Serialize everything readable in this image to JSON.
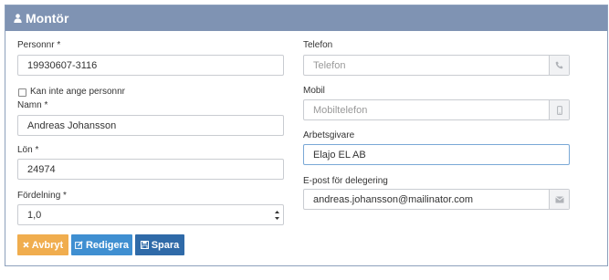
{
  "panel": {
    "title": "Montör"
  },
  "left": {
    "personnr_label": "Personnr *",
    "personnr_value": "19930607-3116",
    "no_personnr_label": "Kan inte ange personnr",
    "namn_label": "Namn *",
    "namn_value": "Andreas Johansson",
    "lon_label": "Lön *",
    "lon_value": "24974",
    "fordelning_label": "Fördelning *",
    "fordelning_value": "1,0"
  },
  "right": {
    "telefon_label": "Telefon",
    "telefon_placeholder": "Telefon",
    "mobil_label": "Mobil",
    "mobil_placeholder": "Mobiltelefon",
    "arbetsgivare_label": "Arbetsgivare",
    "arbetsgivare_value": "Elajo EL AB",
    "epost_label": "E-post för delegering",
    "epost_value": "andreas.johansson@mailinator.com"
  },
  "buttons": {
    "cancel": "Avbryt",
    "edit": "Redigera",
    "save": "Spara"
  },
  "colors": {
    "header": "#7f93b3",
    "cancel": "#f0ad4e",
    "edit": "#3f8fd1",
    "save": "#2f6aa8"
  }
}
